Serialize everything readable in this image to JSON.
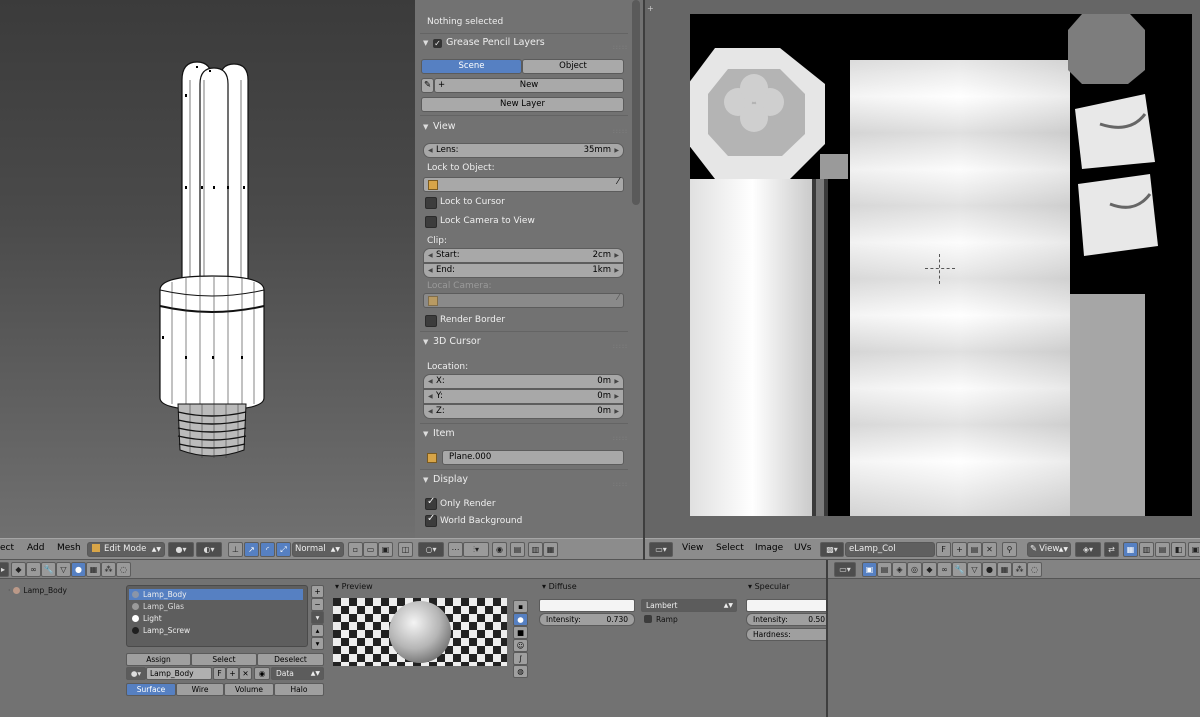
{
  "npanel": {
    "top_status": "Nothing selected",
    "grease": {
      "title": "Grease Pencil Layers",
      "scene_tab": "Scene",
      "object_tab": "Object",
      "new_label": "New",
      "new_layer_label": "New Layer"
    },
    "view": {
      "title": "View",
      "lens_label": "Lens:",
      "lens_value": "35mm",
      "lock_to_object_label": "Lock to Object:",
      "lock_to_cursor_label": "Lock to Cursor",
      "lock_camera_label": "Lock Camera to View",
      "clip_label": "Clip:",
      "start_label": "Start:",
      "start_value": "2cm",
      "end_label": "End:",
      "end_value": "1km",
      "local_camera_label": "Local Camera:",
      "render_border_label": "Render Border"
    },
    "cursor": {
      "title": "3D Cursor",
      "location_label": "Location:",
      "x_label": "X:",
      "x_value": "0m",
      "y_label": "Y:",
      "y_value": "0m",
      "z_label": "Z:",
      "z_value": "0m"
    },
    "item": {
      "title": "Item",
      "name": "Plane.000"
    },
    "display": {
      "title": "Display",
      "only_render_label": "Only Render",
      "world_background_label": "World Background"
    }
  },
  "header3d": {
    "select_label": "ect",
    "add_label": "Add",
    "mesh_label": "Mesh",
    "mode_label": "Edit Mode",
    "pivot_label": "Normal"
  },
  "uv_header": {
    "view_label": "View",
    "select_label": "Select",
    "image_label": "Image",
    "uvs_label": "UVs",
    "image_name": "eLamp_Col",
    "fake_user": "F",
    "view2_label": "View"
  },
  "outliner": {
    "object_name": "Lamp_Body"
  },
  "materials": {
    "slots": [
      {
        "name": "Lamp_Body",
        "color": "#8a95a8"
      },
      {
        "name": "Lamp_Glas",
        "color": "#9a9a9a"
      },
      {
        "name": "Light",
        "color": "#ffffff"
      },
      {
        "name": "Lamp_Screw",
        "color": "#1f1f1f"
      }
    ],
    "assign_label": "Assign",
    "select_label": "Select",
    "deselect_label": "Deselect",
    "material_name": "Lamp_Body",
    "fake_user": "F",
    "link_label": "Data",
    "tabs": [
      "Surface",
      "Wire",
      "Volume",
      "Halo"
    ]
  },
  "preview": {
    "title": "Preview"
  },
  "diffuse": {
    "title": "Diffuse",
    "shader": "Lambert",
    "intensity_label": "Intensity:",
    "intensity_value": "0.730",
    "ramp_label": "Ramp"
  },
  "specular": {
    "title": "Specular",
    "intensity_label": "Intensity:",
    "intensity_value": "0.50",
    "hardness_label": "Hardness:"
  },
  "colors": {
    "selected": "#5680c2",
    "object_orange": "#d8a548"
  }
}
